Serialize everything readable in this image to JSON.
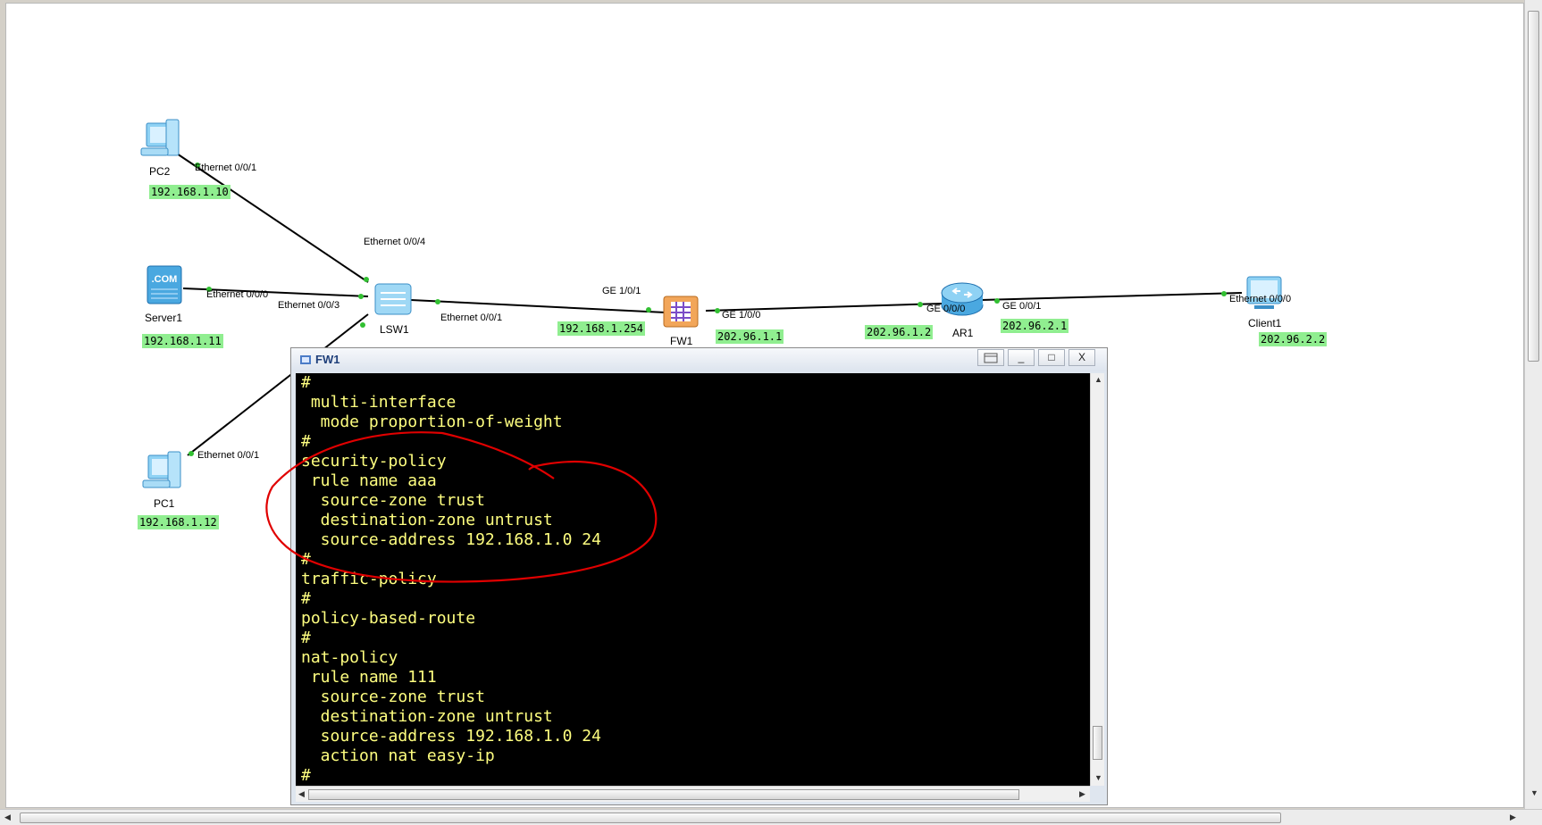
{
  "devices": {
    "pc2": {
      "name": "PC2",
      "ip": "192.168.1.10",
      "port": "Ethernet 0/0/1"
    },
    "server1": {
      "name": "Server1",
      "ip": "192.168.1.11",
      "port": "Ethernet 0/0/0"
    },
    "pc1": {
      "name": "PC1",
      "ip": "192.168.1.12",
      "port": "Ethernet 0/0/1"
    },
    "lsw1": {
      "name": "LSW1",
      "ports": {
        "p4": "Ethernet 0/0/4",
        "p3": "Ethernet 0/0/3",
        "p1": "Ethernet 0/0/1"
      }
    },
    "fw1": {
      "name": "FW1",
      "port_in": "GE 1/0/1",
      "ip_in": "192.168.1.254",
      "port_out": "GE 1/0/0",
      "ip_out": "202.96.1.1"
    },
    "ar1": {
      "name": "AR1",
      "port_in": "GE 0/0/0",
      "ip_in": "202.96.1.2",
      "port_out": "GE 0/0/1",
      "ip_out": "202.96.2.1"
    },
    "client1": {
      "name": "Client1",
      "port": "Ethernet 0/0/0",
      "ip": "202.96.2.2"
    }
  },
  "server_icon_text": ".COM",
  "terminal": {
    "title": "FW1",
    "buttons": {
      "minimize": "_",
      "maximize": "□",
      "close": "X"
    },
    "lines": [
      "#",
      " multi-interface",
      "  mode proportion-of-weight",
      "#",
      "security-policy",
      " rule name aaa",
      "  source-zone trust",
      "  destination-zone untrust",
      "  source-address 192.168.1.0 24",
      "#",
      "traffic-policy",
      "#",
      "policy-based-route",
      "#",
      "nat-policy",
      " rule name 111",
      "  source-zone trust",
      "  destination-zone untrust",
      "  source-address 192.168.1.0 24",
      "  action nat easy-ip",
      "#"
    ],
    "text_color": "#ffff80",
    "bg_color": "#000000"
  },
  "colors": {
    "ip_label_bg": "#90ee90",
    "annotation": "#e00000",
    "link": "#000000"
  }
}
